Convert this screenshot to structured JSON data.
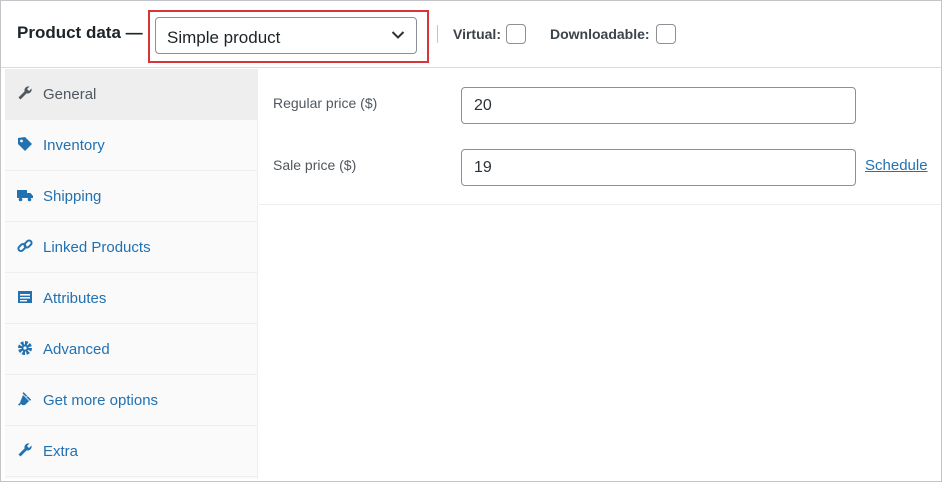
{
  "header": {
    "title": "Product data —",
    "product_type": {
      "selected": "Simple product"
    },
    "virtual_label": "Virtual:",
    "downloadable_label": "Downloadable:"
  },
  "sidebar": {
    "items": [
      {
        "label": "General",
        "icon": "wrench-icon",
        "active": true
      },
      {
        "label": "Inventory",
        "icon": "tag-icon"
      },
      {
        "label": "Shipping",
        "icon": "truck-icon"
      },
      {
        "label": "Linked Products",
        "icon": "link-icon"
      },
      {
        "label": "Attributes",
        "icon": "list-icon"
      },
      {
        "label": "Advanced",
        "icon": "gear-icon"
      },
      {
        "label": "Get more options",
        "icon": "plugin-icon"
      },
      {
        "label": "Extra",
        "icon": "wrench-icon"
      }
    ]
  },
  "general": {
    "regular_price_label": "Regular price ($)",
    "regular_price_value": "20",
    "sale_price_label": "Sale price ($)",
    "sale_price_value": "19",
    "schedule_link": "Schedule"
  },
  "colors": {
    "accent": "#2271b1",
    "highlight": "#d63638"
  }
}
